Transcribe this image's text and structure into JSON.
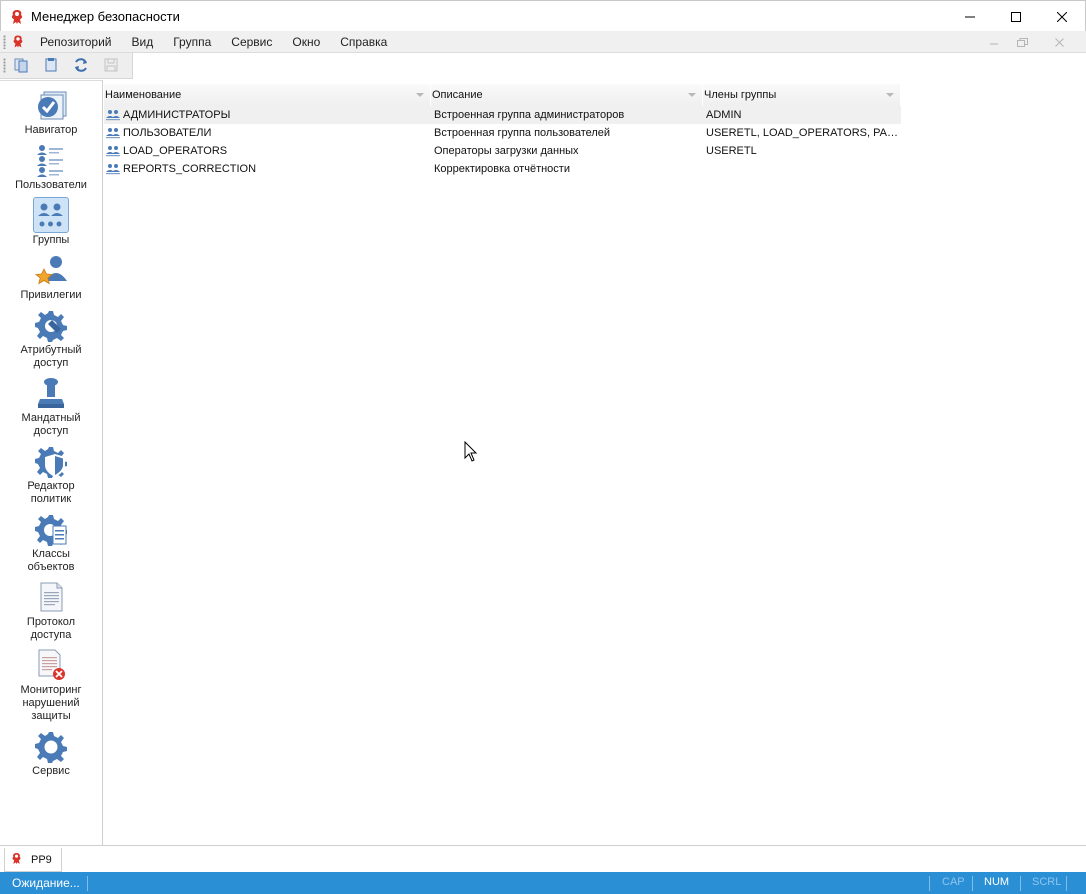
{
  "window": {
    "title": "Менеджер безопасности"
  },
  "menu": {
    "items": [
      "Репозиторий",
      "Вид",
      "Группа",
      "Сервис",
      "Окно",
      "Справка"
    ]
  },
  "navigation": {
    "active": "Группы",
    "items": [
      {
        "label": "Навигатор",
        "icon": "navigator-icon"
      },
      {
        "label": "Пользователи",
        "icon": "users-icon"
      },
      {
        "label": "Группы",
        "icon": "groups-icon"
      },
      {
        "label": "Привилегии",
        "icon": "privileges-icon"
      },
      {
        "label": "Атрибутный\nдоступ",
        "icon": "attribute-access-icon"
      },
      {
        "label": "Мандатный\nдоступ",
        "icon": "mandatory-access-icon"
      },
      {
        "label": "Редактор\nполитик",
        "icon": "policy-editor-icon"
      },
      {
        "label": "Классы\nобъектов",
        "icon": "object-classes-icon"
      },
      {
        "label": "Протокол\nдоступа",
        "icon": "access-log-icon"
      },
      {
        "label": "Мониторинг\nнарушений\nзащиты",
        "icon": "security-violations-icon"
      },
      {
        "label": "Сервис",
        "icon": "service-icon"
      }
    ]
  },
  "grid": {
    "columns": [
      "Наименование",
      "Описание",
      "Члены группы"
    ],
    "rows": [
      {
        "name": "АДМИНИСТРАТОРЫ",
        "description": "Встроенная группа администраторов",
        "members": "ADMIN"
      },
      {
        "name": "ПОЛЬЗОВАТЕЛИ",
        "description": "Встроенная группа пользователей",
        "members": "USERETL, LOAD_OPERATORS, PART..."
      },
      {
        "name": "LOAD_OPERATORS",
        "description": "Операторы загрузки данных",
        "members": "USERETL"
      },
      {
        "name": "REPORTS_CORRECTION",
        "description": "Корректировка отчётности",
        "members": ""
      }
    ]
  },
  "tabs": {
    "documents": [
      "PP9"
    ]
  },
  "status": {
    "text": "Ожидание...",
    "indicators": [
      {
        "label": "CAP",
        "active": false
      },
      {
        "label": "NUM",
        "active": true
      },
      {
        "label": "SCRL",
        "active": false
      }
    ]
  },
  "colors": {
    "accent": "#2b8fd6",
    "icon_blue": "#4a7bb7",
    "app_red": "#d9342b"
  }
}
